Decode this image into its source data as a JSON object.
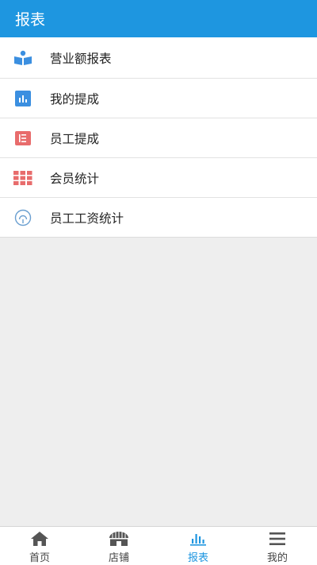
{
  "header": {
    "title": "报表"
  },
  "menu": [
    {
      "label": "营业额报表",
      "icon": "book-reader-icon",
      "color": "#3b8fe0"
    },
    {
      "label": "我的提成",
      "icon": "bar-chart-icon",
      "color": "#3b8fe0"
    },
    {
      "label": "员工提成",
      "icon": "list-card-icon",
      "color": "#e86c6c"
    },
    {
      "label": "会员统计",
      "icon": "grid-icon",
      "color": "#e86c6c"
    },
    {
      "label": "员工工资统计",
      "icon": "salary-circle-icon",
      "color": "#6a9fd0"
    }
  ],
  "tabs": [
    {
      "label": "首页",
      "icon": "home-icon",
      "active": false
    },
    {
      "label": "店铺",
      "icon": "store-icon",
      "active": false
    },
    {
      "label": "报表",
      "icon": "report-chart-icon",
      "active": true
    },
    {
      "label": "我的",
      "icon": "menu-lines-icon",
      "active": false
    }
  ],
  "colors": {
    "accent": "#1e96e0",
    "background": "#eeeeee"
  }
}
